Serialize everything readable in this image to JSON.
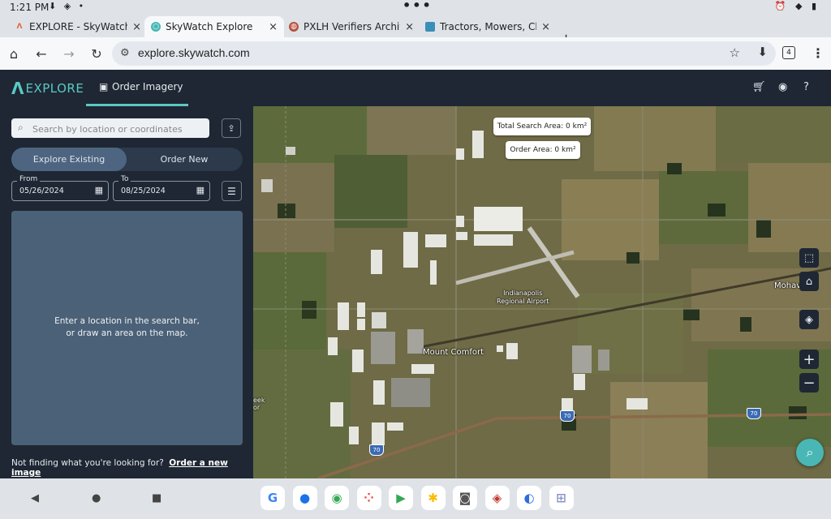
{
  "status_bar": {
    "time": "1:21 PM",
    "left_icons": "⬇ ◈ •",
    "center_dots": "•••",
    "right_icons": "⏰ ◆ ▮"
  },
  "tabs": [
    {
      "title": "EXPLORE - SkyWatch",
      "favicon": "skywatch-logo-icon",
      "close": "×"
    },
    {
      "title": "SkyWatch Explore",
      "favicon": "skywatch-globe-icon",
      "close": "×"
    },
    {
      "title": "PXLH Verifiers Archives",
      "favicon": "planet-icon",
      "close": "×"
    },
    {
      "title": "Tractors, Mowers, Chippers",
      "favicon": "image-icon",
      "close": "×"
    }
  ],
  "new_tab": "+",
  "toolbar": {
    "url": "explore.skywatch.com",
    "tab_count": "4"
  },
  "app": {
    "logo_text": "EXPLORE",
    "nav_order": "Order Imagery",
    "accent": "#5ac9c5"
  },
  "sidebar": {
    "search_placeholder": "Search by location or coordinates",
    "mode_explore": "Explore Existing",
    "mode_order": "Order New",
    "from_label": "From",
    "from_value": "05/26/2024",
    "to_label": "To",
    "to_value": "08/25/2024",
    "empty_line1": "Enter a location in the search bar,",
    "empty_line2": "or draw an area on the map.",
    "footer_text": "Not finding what you're looking for?",
    "footer_link": "Order a new image"
  },
  "map": {
    "total_search_area": "Total Search Area: 0 km²",
    "order_area": "Order Area: 0 km²",
    "label_airport_1": "Indianapolis",
    "label_airport_2": "Regional Airport",
    "label_town": "Mount Comfort",
    "label_mohawk": "Mohav",
    "label_creek_1": "eek",
    "label_creek_2": "or",
    "shield_70": "70",
    "zoom_in": "+",
    "zoom_out": "−"
  },
  "android_nav": {
    "back": "◀",
    "home": "●",
    "recents": "■"
  },
  "dock": [
    {
      "name": "google-app-icon",
      "glyph": "G",
      "color": "#4285f4"
    },
    {
      "name": "messages-app-icon",
      "glyph": "●",
      "color": "#1a73e8"
    },
    {
      "name": "chrome-app-icon",
      "glyph": "◉",
      "color": "#34a853"
    },
    {
      "name": "assistant-app-icon",
      "glyph": "⁘",
      "color": "#ea4335"
    },
    {
      "name": "play-store-app-icon",
      "glyph": "▶",
      "color": "#34a853"
    },
    {
      "name": "photos-app-icon",
      "glyph": "✱",
      "color": "#fbbc05"
    },
    {
      "name": "camera-app-icon",
      "glyph": "◙",
      "color": "#555555"
    },
    {
      "name": "custom-app-icon",
      "glyph": "◈",
      "color": "#c0392b"
    },
    {
      "name": "browser-app-icon",
      "glyph": "◐",
      "color": "#2d6cdf"
    },
    {
      "name": "app-drawer-icon",
      "glyph": "⊞",
      "color": "#8a93c9"
    }
  ]
}
